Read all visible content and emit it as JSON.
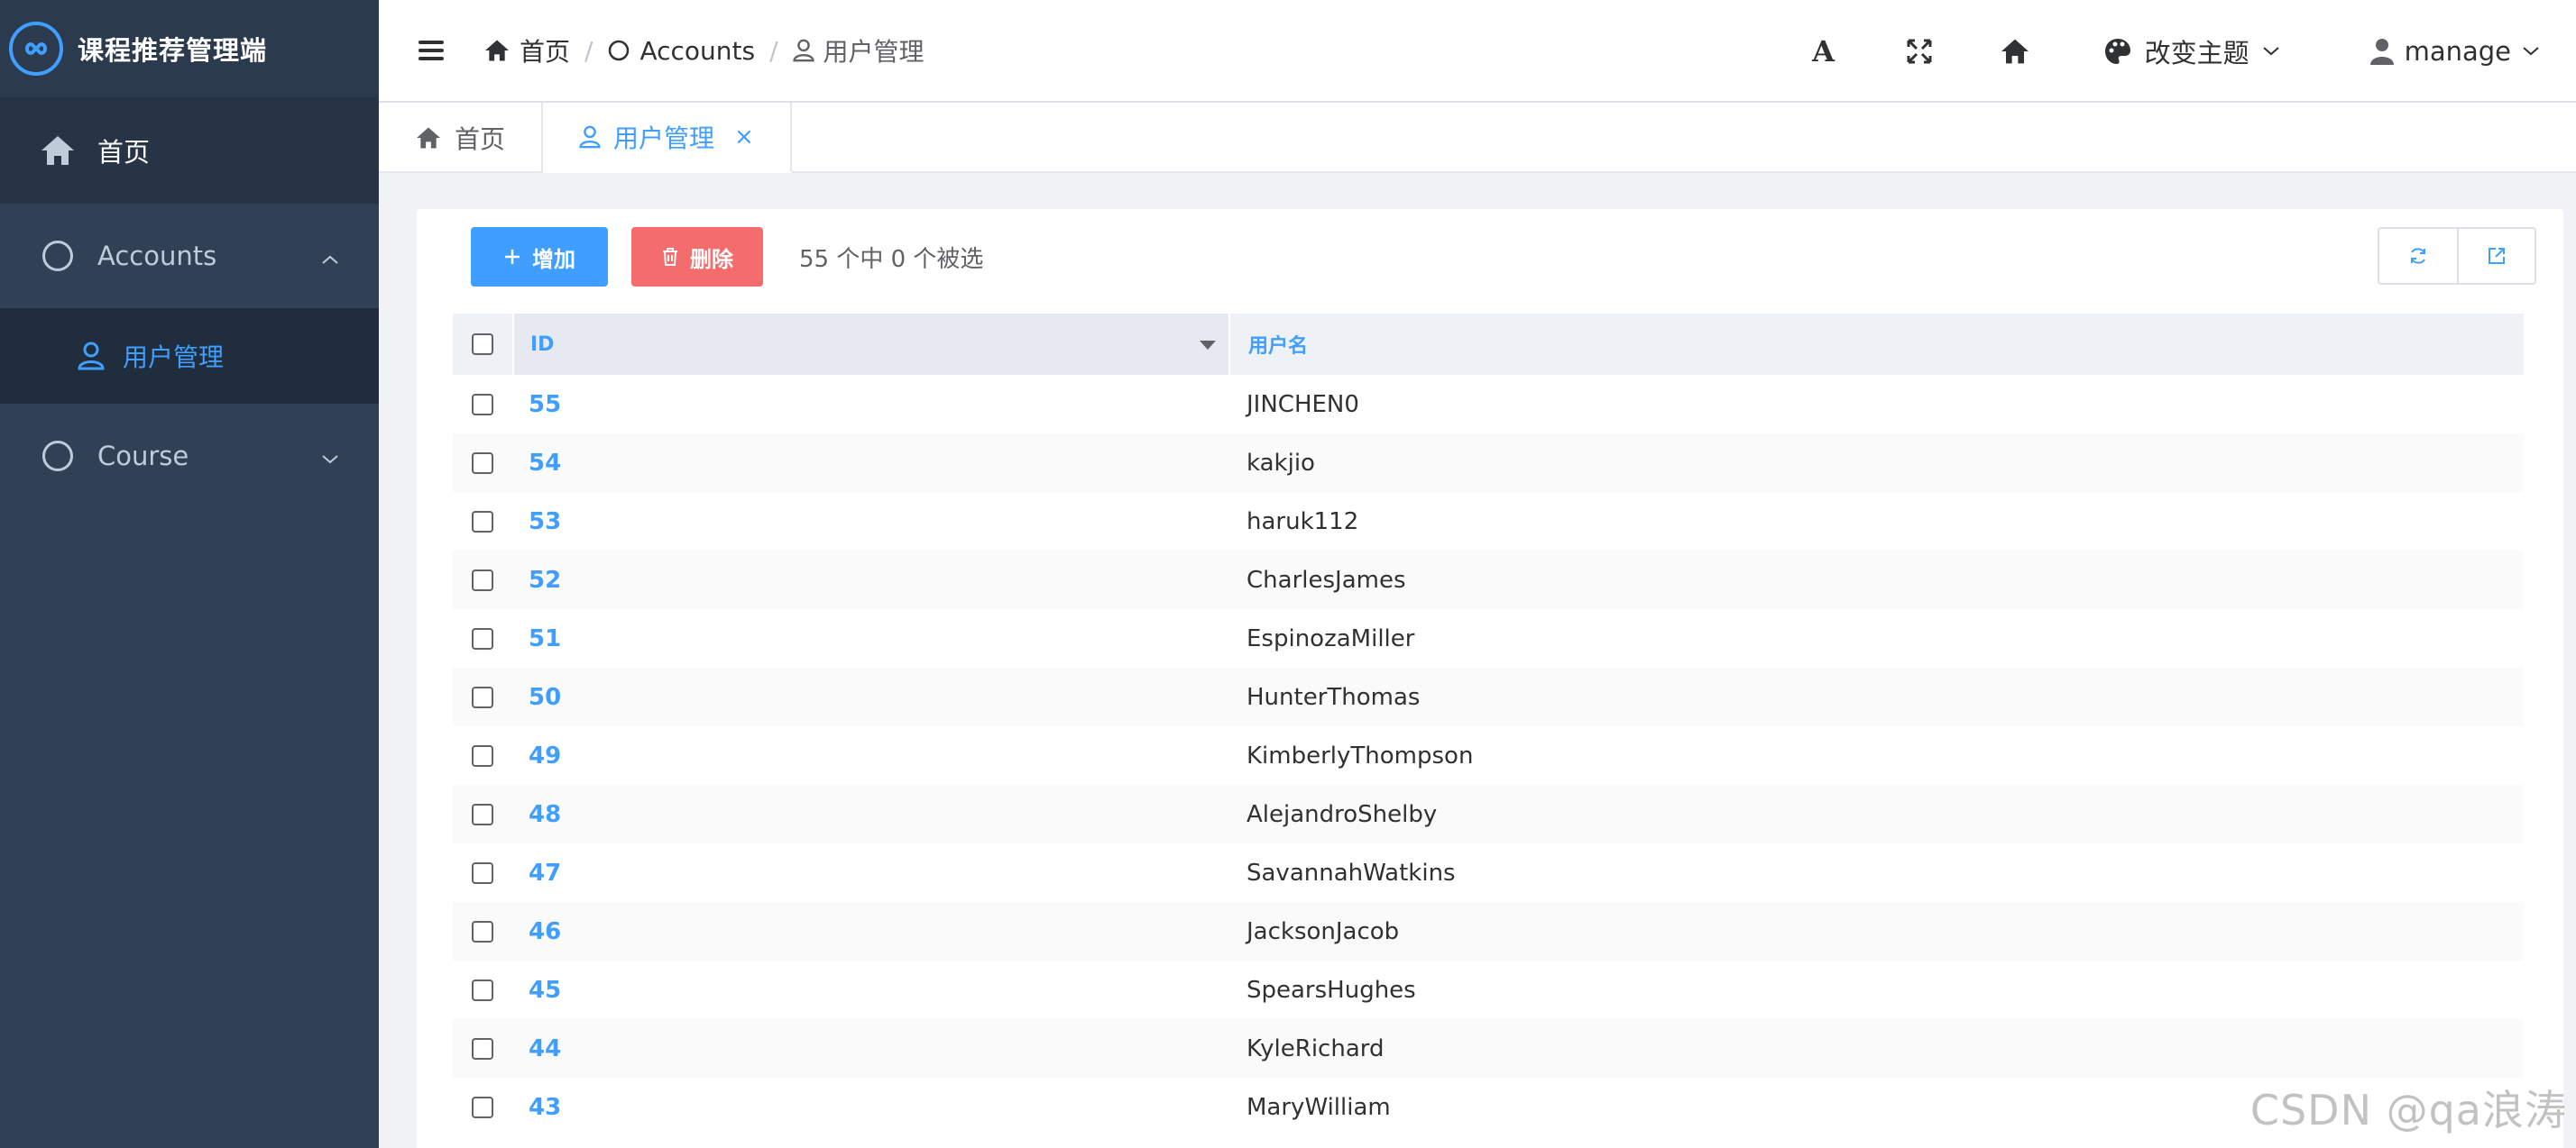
{
  "app": {
    "title": "课程推荐管理端",
    "accent": "#409eff"
  },
  "sidebar": {
    "home_label": "首页",
    "accounts_label": "Accounts",
    "user_mgmt_label": "用户管理",
    "course_label": "Course"
  },
  "header": {
    "breadcrumb": {
      "home": "首页",
      "accounts": "Accounts",
      "current": "用户管理",
      "sep": "/"
    },
    "theme_label": "改变主题",
    "user_label": "manage",
    "font_icon_text": "A"
  },
  "tabs": [
    {
      "label": "首页"
    },
    {
      "label": "用户管理",
      "close": "×"
    }
  ],
  "toolbar": {
    "add_label": "增加",
    "delete_label": "删除",
    "selection_info": "55 个中 0 个被选"
  },
  "table": {
    "columns": [
      "ID",
      "用户名"
    ],
    "rows": [
      {
        "id": "55",
        "name": "JINCHEN0"
      },
      {
        "id": "54",
        "name": "kakjio"
      },
      {
        "id": "53",
        "name": "haruk112"
      },
      {
        "id": "52",
        "name": "CharlesJames"
      },
      {
        "id": "51",
        "name": "EspinozaMiller"
      },
      {
        "id": "50",
        "name": "HunterThomas"
      },
      {
        "id": "49",
        "name": "KimberlyThompson"
      },
      {
        "id": "48",
        "name": "AlejandroShelby"
      },
      {
        "id": "47",
        "name": "SavannahWatkins"
      },
      {
        "id": "46",
        "name": "JacksonJacob"
      },
      {
        "id": "45",
        "name": "SpearsHughes"
      },
      {
        "id": "44",
        "name": "KyleRichard"
      },
      {
        "id": "43",
        "name": "MaryWilliam"
      }
    ]
  },
  "watermark": "CSDN @qa浪涛"
}
